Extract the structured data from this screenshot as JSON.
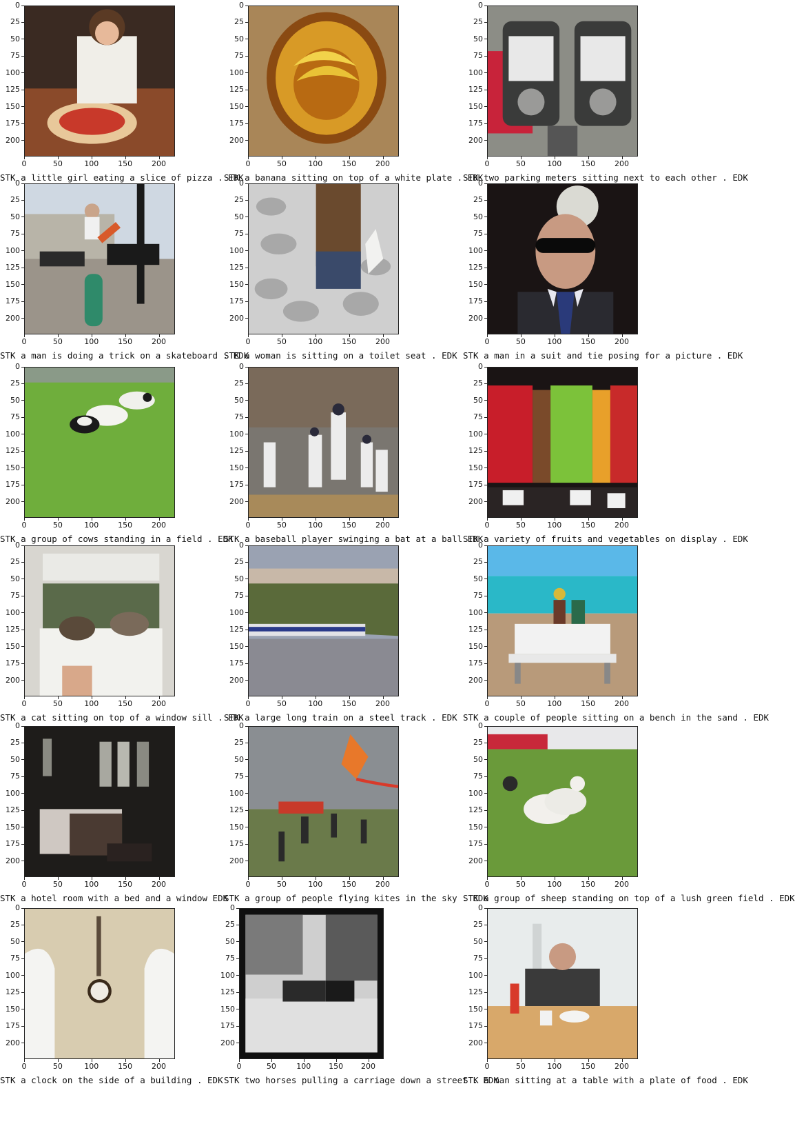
{
  "panels": [
    {
      "caption": "STK a little girl eating a slice of pizza . EDK"
    },
    {
      "caption": "STK a banana sitting on top of a white plate . EDK"
    },
    {
      "caption": "STK two parking meters sitting next to each other . EDK"
    },
    {
      "caption": "STK a man is doing a trick on a skateboard . EDK"
    },
    {
      "caption": "STK a woman is sitting on a toilet seat . EDK"
    },
    {
      "caption": "STK a man in a suit and tie posing for a picture . EDK"
    },
    {
      "caption": "STK a group of cows standing in a field . EDK"
    },
    {
      "caption": "STK a baseball player swinging a bat at a ball EDK"
    },
    {
      "caption": "STK a variety of fruits and vegetables on display . EDK"
    },
    {
      "caption": "STK a cat sitting on top of a window sill . EDK"
    },
    {
      "caption": "STK a large long train on a steel track . EDK"
    },
    {
      "caption": "STK a couple of people sitting on a bench in the sand . EDK"
    },
    {
      "caption": "STK a hotel room with a bed and a window EDK"
    },
    {
      "caption": "STK a group of people flying kites in the sky . EDK"
    },
    {
      "caption": "STK a group of sheep standing on top of a lush green field . EDK"
    },
    {
      "caption": "STK a clock on the side of a building . EDK"
    },
    {
      "caption": "STK two horses pulling a carriage down a street . EDK"
    },
    {
      "caption": "STK a man sitting at a table with a plate of food . EDK"
    }
  ],
  "axes": {
    "y_ticks": [
      "0",
      "25",
      "50",
      "75",
      "100",
      "125",
      "150",
      "175",
      "200"
    ],
    "x_ticks": [
      "0",
      "50",
      "100",
      "150",
      "200"
    ]
  }
}
